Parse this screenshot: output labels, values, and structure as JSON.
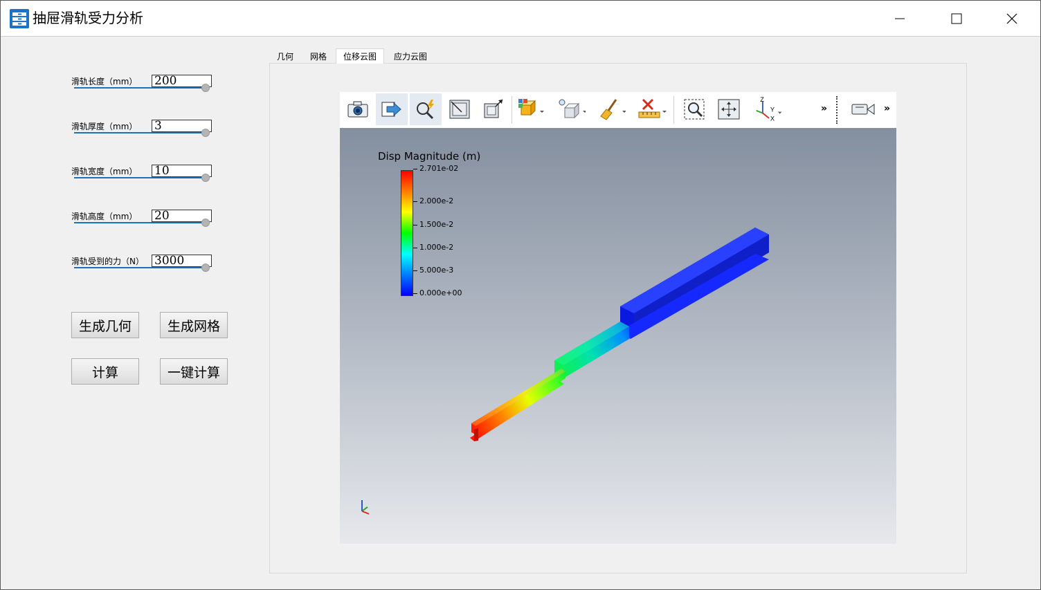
{
  "window": {
    "title": "抽屉滑轨受力分析"
  },
  "params": [
    {
      "label": "滑轨长度（mm）",
      "value": "200"
    },
    {
      "label": "滑轨厚度（mm）",
      "value": "3"
    },
    {
      "label": "滑轨宽度（mm）",
      "value": "10"
    },
    {
      "label": "滑轨高度（mm）",
      "value": "20"
    },
    {
      "label": "滑轨受到的力（N）",
      "value": "3000"
    }
  ],
  "buttons": {
    "gen_geometry": "生成几何",
    "gen_mesh": "生成网格",
    "compute": "计算",
    "one_click": "一键计算"
  },
  "tabs": [
    {
      "label": "几何"
    },
    {
      "label": "网格"
    },
    {
      "label": "位移云图",
      "active": true
    },
    {
      "label": "应力云图"
    }
  ],
  "toolbar": {
    "items": [
      "camera-icon",
      "export-icon",
      "interactive-select-icon",
      "reset-box-icon",
      "screenshot-box-icon",
      "representation-icon",
      "lighting-icon",
      "clear-icon",
      "ruler-icon",
      "zoom-to-box-icon",
      "reset-camera-icon",
      "axes-orientation-icon",
      "camera-settings-icon"
    ],
    "more": "»"
  },
  "legend": {
    "title": "Disp Magnitude (m)",
    "ticks": [
      "2.701e-02",
      "2.000e-2",
      "1.500e-2",
      "1.000e-2",
      "5.000e-3",
      "0.000e+00"
    ]
  },
  "axes": {
    "z": "Z",
    "y": "Y",
    "x": "X"
  },
  "colors": {
    "accent": "#1c6fb8",
    "titlebar": "#ffffff",
    "bg": "#f0f0f0"
  }
}
